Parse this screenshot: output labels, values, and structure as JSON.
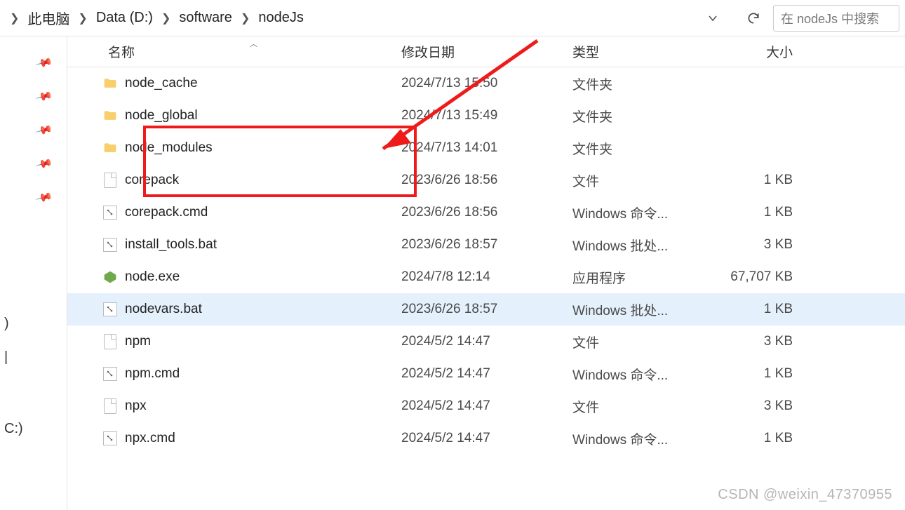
{
  "breadcrumbs": [
    "此电脑",
    "Data (D:)",
    "software",
    "nodeJs"
  ],
  "search_placeholder": "在 nodeJs 中搜索",
  "columns": {
    "name": "名称",
    "date": "修改日期",
    "type": "类型",
    "size": "大小"
  },
  "sidebar_labels": {
    "l1": ")",
    "l2": "|",
    "l3": "C:)"
  },
  "files": [
    {
      "icon": "folder",
      "name": "node_cache",
      "date": "2024/7/13 15:50",
      "type": "文件夹",
      "size": ""
    },
    {
      "icon": "folder",
      "name": "node_global",
      "date": "2024/7/13 15:49",
      "type": "文件夹",
      "size": ""
    },
    {
      "icon": "folder",
      "name": "node_modules",
      "date": "2024/7/13 14:01",
      "type": "文件夹",
      "size": ""
    },
    {
      "icon": "file",
      "name": "corepack",
      "date": "2023/6/26 18:56",
      "type": "文件",
      "size": "1 KB"
    },
    {
      "icon": "cmd",
      "name": "corepack.cmd",
      "date": "2023/6/26 18:56",
      "type": "Windows 命令...",
      "size": "1 KB"
    },
    {
      "icon": "cmd",
      "name": "install_tools.bat",
      "date": "2023/6/26 18:57",
      "type": "Windows 批处...",
      "size": "3 KB"
    },
    {
      "icon": "exe",
      "name": "node.exe",
      "date": "2024/7/8 12:14",
      "type": "应用程序",
      "size": "67,707 KB"
    },
    {
      "icon": "cmd",
      "name": "nodevars.bat",
      "date": "2023/6/26 18:57",
      "type": "Windows 批处...",
      "size": "1 KB",
      "selected": true
    },
    {
      "icon": "file",
      "name": "npm",
      "date": "2024/5/2 14:47",
      "type": "文件",
      "size": "3 KB"
    },
    {
      "icon": "cmd",
      "name": "npm.cmd",
      "date": "2024/5/2 14:47",
      "type": "Windows 命令...",
      "size": "1 KB"
    },
    {
      "icon": "file",
      "name": "npx",
      "date": "2024/5/2 14:47",
      "type": "文件",
      "size": "3 KB"
    },
    {
      "icon": "cmd",
      "name": "npx.cmd",
      "date": "2024/5/2 14:47",
      "type": "Windows 命令...",
      "size": "1 KB"
    }
  ],
  "watermark": "CSDN @weixin_47370955",
  "annotation": {
    "highlighted_rows": [
      "node_cache",
      "node_global"
    ]
  }
}
